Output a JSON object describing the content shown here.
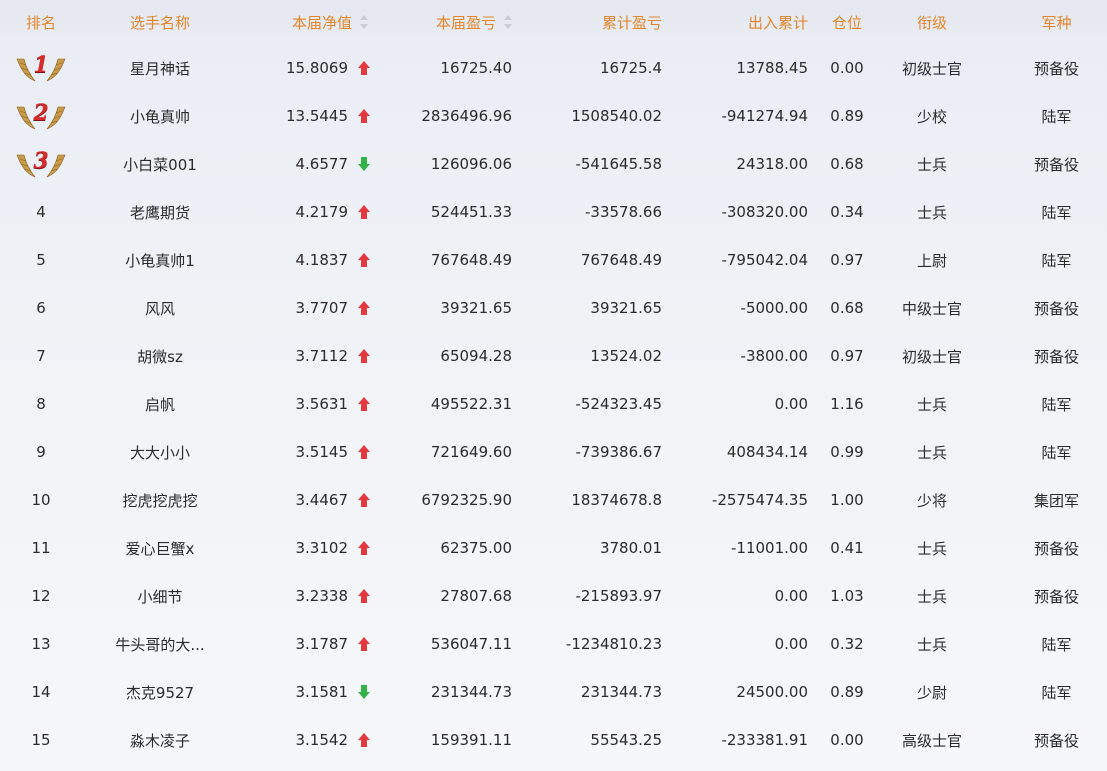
{
  "headers": {
    "rank": "排名",
    "name": "选手名称",
    "nav": "本届净值",
    "current_pl": "本届盈亏",
    "cumulative_pl": "累计盈亏",
    "inout": "出入累计",
    "position": "仓位",
    "title": "衔级",
    "branch": "军种"
  },
  "colors": {
    "header_text": "#e2862d",
    "up": "#e0393e",
    "down": "#33b24a",
    "medal_number": "#d72c2c"
  },
  "rows": [
    {
      "rank": "1",
      "name": "星月神话",
      "nav": "15.8069",
      "trend": "up",
      "current_pl": "16725.40",
      "cumulative_pl": "16725.4",
      "inout": "13788.45",
      "position": "0.00",
      "title": "初级士官",
      "branch": "预备役"
    },
    {
      "rank": "2",
      "name": "小龟真帅",
      "nav": "13.5445",
      "trend": "up",
      "current_pl": "2836496.96",
      "cumulative_pl": "1508540.02",
      "inout": "-941274.94",
      "position": "0.89",
      "title": "少校",
      "branch": "陆军"
    },
    {
      "rank": "3",
      "name": "小白菜001",
      "nav": "4.6577",
      "trend": "down",
      "current_pl": "126096.06",
      "cumulative_pl": "-541645.58",
      "inout": "24318.00",
      "position": "0.68",
      "title": "士兵",
      "branch": "预备役"
    },
    {
      "rank": "4",
      "name": "老鹰期货",
      "nav": "4.2179",
      "trend": "up",
      "current_pl": "524451.33",
      "cumulative_pl": "-33578.66",
      "inout": "-308320.00",
      "position": "0.34",
      "title": "士兵",
      "branch": "陆军"
    },
    {
      "rank": "5",
      "name": "小龟真帅1",
      "nav": "4.1837",
      "trend": "up",
      "current_pl": "767648.49",
      "cumulative_pl": "767648.49",
      "inout": "-795042.04",
      "position": "0.97",
      "title": "上尉",
      "branch": "陆军"
    },
    {
      "rank": "6",
      "name": "风风",
      "nav": "3.7707",
      "trend": "up",
      "current_pl": "39321.65",
      "cumulative_pl": "39321.65",
      "inout": "-5000.00",
      "position": "0.68",
      "title": "中级士官",
      "branch": "预备役"
    },
    {
      "rank": "7",
      "name": "胡微sz",
      "nav": "3.7112",
      "trend": "up",
      "current_pl": "65094.28",
      "cumulative_pl": "13524.02",
      "inout": "-3800.00",
      "position": "0.97",
      "title": "初级士官",
      "branch": "预备役"
    },
    {
      "rank": "8",
      "name": "启帆",
      "nav": "3.5631",
      "trend": "up",
      "current_pl": "495522.31",
      "cumulative_pl": "-524323.45",
      "inout": "0.00",
      "position": "1.16",
      "title": "士兵",
      "branch": "陆军"
    },
    {
      "rank": "9",
      "name": "大大小小",
      "nav": "3.5145",
      "trend": "up",
      "current_pl": "721649.60",
      "cumulative_pl": "-739386.67",
      "inout": "408434.14",
      "position": "0.99",
      "title": "士兵",
      "branch": "陆军"
    },
    {
      "rank": "10",
      "name": "挖虎挖虎挖",
      "nav": "3.4467",
      "trend": "up",
      "current_pl": "6792325.90",
      "cumulative_pl": "18374678.8",
      "inout": "-2575474.35",
      "position": "1.00",
      "title": "少将",
      "branch": "集团军"
    },
    {
      "rank": "11",
      "name": "爱心巨蟹x",
      "nav": "3.3102",
      "trend": "up",
      "current_pl": "62375.00",
      "cumulative_pl": "3780.01",
      "inout": "-11001.00",
      "position": "0.41",
      "title": "士兵",
      "branch": "预备役"
    },
    {
      "rank": "12",
      "name": "小细节",
      "nav": "3.2338",
      "trend": "up",
      "current_pl": "27807.68",
      "cumulative_pl": "-215893.97",
      "inout": "0.00",
      "position": "1.03",
      "title": "士兵",
      "branch": "预备役"
    },
    {
      "rank": "13",
      "name": "牛头哥的大...",
      "nav": "3.1787",
      "trend": "up",
      "current_pl": "536047.11",
      "cumulative_pl": "-1234810.23",
      "inout": "0.00",
      "position": "0.32",
      "title": "士兵",
      "branch": "陆军"
    },
    {
      "rank": "14",
      "name": "杰克9527",
      "nav": "3.1581",
      "trend": "down",
      "current_pl": "231344.73",
      "cumulative_pl": "231344.73",
      "inout": "24500.00",
      "position": "0.89",
      "title": "少尉",
      "branch": "陆军"
    },
    {
      "rank": "15",
      "name": "淼木凌子",
      "nav": "3.1542",
      "trend": "up",
      "current_pl": "159391.11",
      "cumulative_pl": "55543.25",
      "inout": "-233381.91",
      "position": "0.00",
      "title": "高级士官",
      "branch": "预备役"
    }
  ]
}
